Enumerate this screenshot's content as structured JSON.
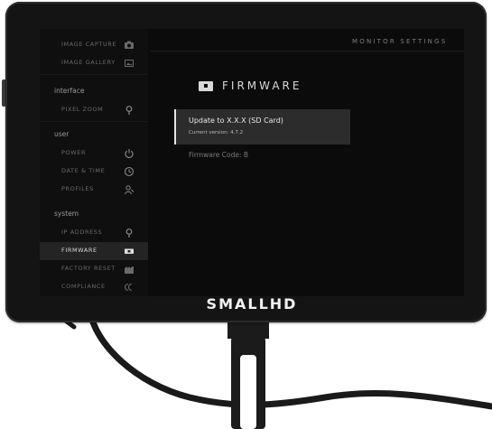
{
  "brand": "SMALLHD",
  "header": {
    "title": "MONITOR SETTINGS"
  },
  "sidebar": {
    "top_items": [
      {
        "label": "IMAGE CAPTURE",
        "icon": "camera-icon"
      },
      {
        "label": "IMAGE GALLERY",
        "icon": "image-gallery-icon"
      }
    ],
    "sections": [
      {
        "title": "interface",
        "items": [
          {
            "label": "PIXEL ZOOM",
            "icon": "pin-icon"
          }
        ]
      },
      {
        "title": "user",
        "items": [
          {
            "label": "POWER",
            "icon": "power-icon"
          },
          {
            "label": "DATE & TIME",
            "icon": "clock-icon"
          },
          {
            "label": "PROFILES",
            "icon": "profile-icon"
          }
        ]
      },
      {
        "title": "system",
        "items": [
          {
            "label": "IP ADDRESS",
            "icon": "location-pin-icon"
          },
          {
            "label": "FIRMWARE",
            "icon": "sd-card-icon",
            "active": true
          },
          {
            "label": "FACTORY RESET",
            "icon": "factory-reset-icon"
          },
          {
            "label": "COMPLIANCE",
            "icon": "compliance-icon"
          }
        ]
      }
    ]
  },
  "main": {
    "title": "FIRMWARE",
    "title_icon": "sd-card-icon",
    "option": {
      "title": "Update to X.X.X (SD Card)",
      "subtitle": "Current version: 4.7.2"
    },
    "firmware_code": "Firmware Code: B"
  },
  "colors": {
    "bezel": "#141414",
    "screen": "#0b0b0b",
    "active_row": "#242424",
    "option_bg": "#2c2c2c",
    "text_main": "#d9d9d9"
  }
}
